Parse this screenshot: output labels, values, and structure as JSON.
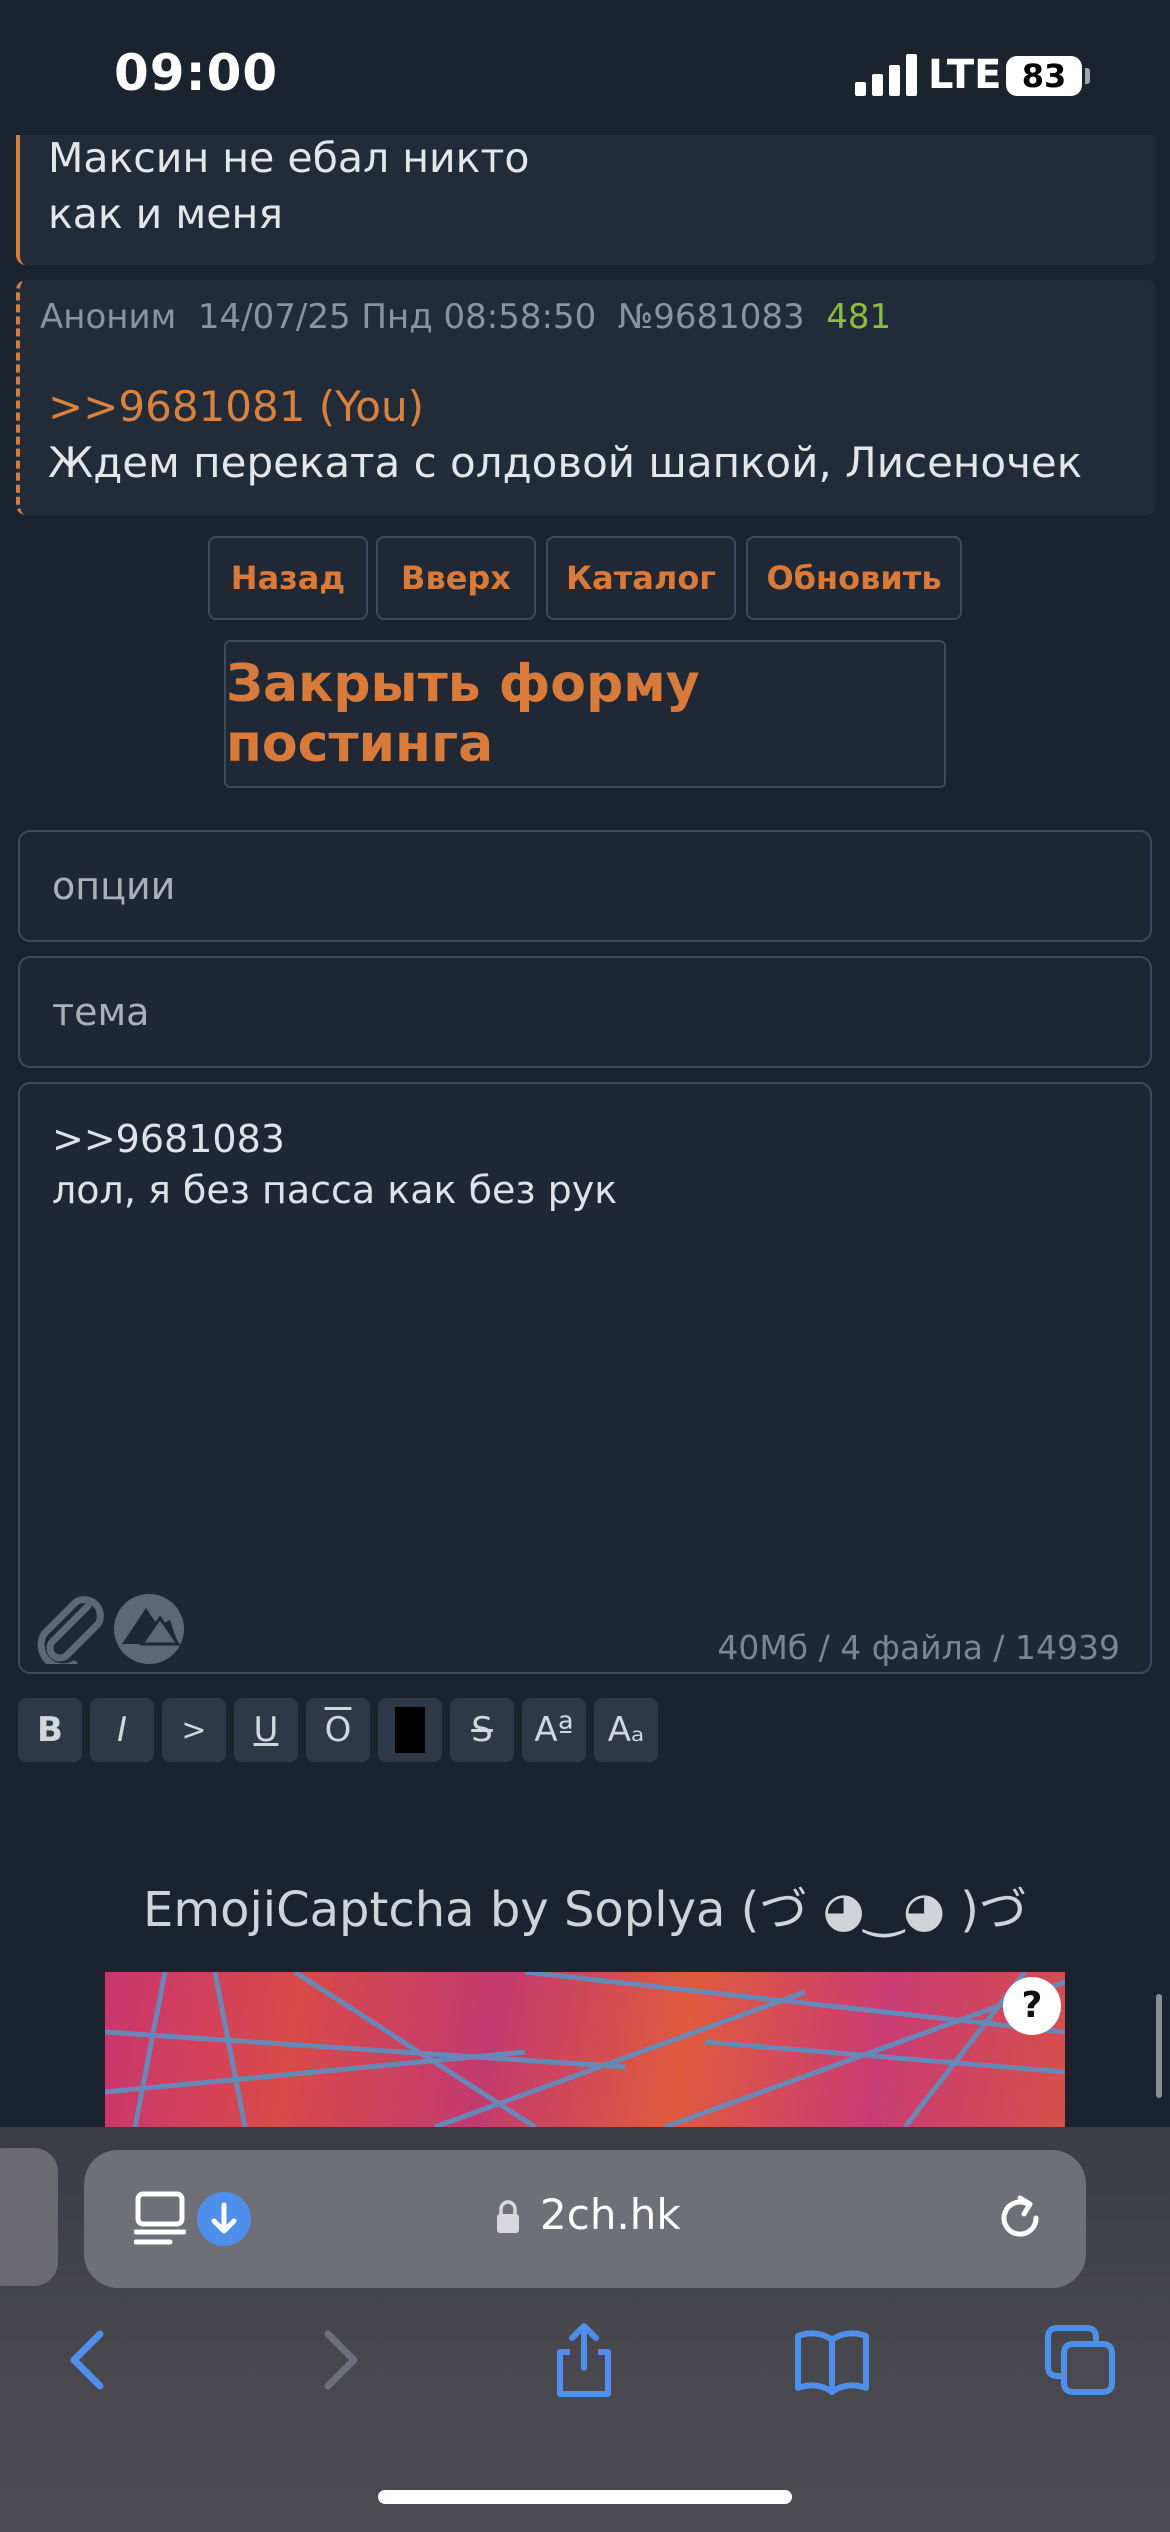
{
  "status_bar": {
    "time": "09:00",
    "network": "LTE",
    "battery": "83"
  },
  "posts": [
    {
      "lines": [
        "Максин не ебал никто",
        "как и меня"
      ]
    },
    {
      "meta": {
        "author": "Аноним",
        "datetime": "14/07/25 Пнд 08:58:50",
        "number": "№9681083",
        "replies": "481"
      },
      "reply_to": ">>9681081 (You)",
      "text": "Ждем переката с олдовой шапкой, Лисеночек"
    }
  ],
  "nav": {
    "back": "Назад",
    "up": "Вверх",
    "catalog": "Каталог",
    "refresh": "Обновить"
  },
  "close_form": "Закрыть форму постинга",
  "form": {
    "options_placeholder": "опции",
    "subject_placeholder": "тема",
    "message_lines": [
      ">>9681083",
      "лол, я без пасса как без рук"
    ],
    "limits": "40Мб / 4 файла / 14939"
  },
  "markup": {
    "bold": "B",
    "italic": "I",
    "quote": ">",
    "underline": "U",
    "overline": "O",
    "spoiler": "",
    "strike": "S",
    "sup": "Aª",
    "sub": "Aₐ"
  },
  "captcha": {
    "title": "EmojiCaptcha by Soplya (づ ◕‿◕ )づ",
    "help": "?"
  },
  "browser": {
    "url": "2ch.hk"
  },
  "colors": {
    "accent": "#d77a3a",
    "background": "#1b232f",
    "panel": "#222b38",
    "replies": "#8bbd3e",
    "ios_blue": "#4d8fea"
  }
}
